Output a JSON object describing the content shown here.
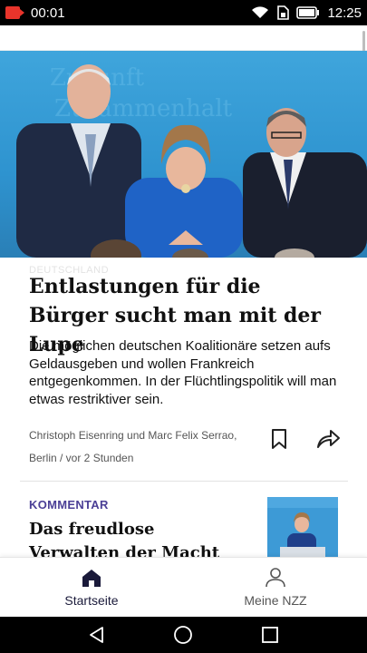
{
  "status_bar": {
    "left_time": "00:01",
    "right_time": "12:25",
    "icons": [
      "record-icon",
      "wifi-icon",
      "sim-icon",
      "battery-icon"
    ]
  },
  "article": {
    "kicker": "DEUTSCHLAND",
    "headline": "Entlastungen für die Bürger sucht man mit der Lupe",
    "lead": "Die möglichen deutschen Koalitionäre setzen aufs Geldausgeben und wollen Frankreich entgegenkommen. In der Flüchtlingspolitik will man etwas restriktiver sein.",
    "authors": "Christoph Eisenring und Marc Felix Serrao,",
    "place_time": "Berlin / vor 2 Stunden",
    "image_alt": "hero-photo"
  },
  "teaser": {
    "kicker": "KOMMENTAR",
    "title": "Das freudlose Verwalten der Macht"
  },
  "bottom_nav": {
    "items": [
      {
        "label": "Startseite",
        "icon": "home-icon",
        "active": true
      },
      {
        "label": "Meine NZZ",
        "icon": "person-icon",
        "active": false
      }
    ]
  },
  "colors": {
    "accent": "#4b3f96",
    "nav_active": "#1a1a3a"
  }
}
